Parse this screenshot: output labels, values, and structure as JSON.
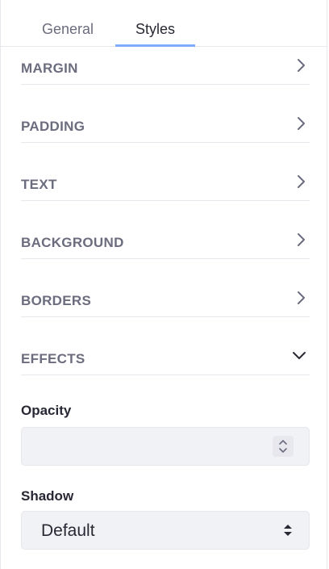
{
  "tabs": [
    {
      "label": "General",
      "active": false
    },
    {
      "label": "Styles",
      "active": true
    }
  ],
  "sections": [
    {
      "label": "MARGIN",
      "expanded": false,
      "icon": "chevron-right-icon"
    },
    {
      "label": "PADDING",
      "expanded": false,
      "icon": "chevron-right-icon"
    },
    {
      "label": "TEXT",
      "expanded": false,
      "icon": "chevron-right-icon"
    },
    {
      "label": "BACKGROUND",
      "expanded": false,
      "icon": "chevron-right-icon"
    },
    {
      "label": "BORDERS",
      "expanded": false,
      "icon": "chevron-right-icon"
    },
    {
      "label": "EFFECTS",
      "expanded": true,
      "icon": "chevron-down-icon"
    }
  ],
  "effects": {
    "opacity": {
      "label": "Opacity",
      "value": "",
      "placeholder": ""
    },
    "shadow": {
      "label": "Shadow",
      "value": "Default"
    }
  },
  "colors": {
    "accent": "#80acff",
    "label": "#6b6c7e",
    "text": "#272833",
    "input_bg": "#f1f2f5",
    "divider": "#e7e7ed"
  }
}
